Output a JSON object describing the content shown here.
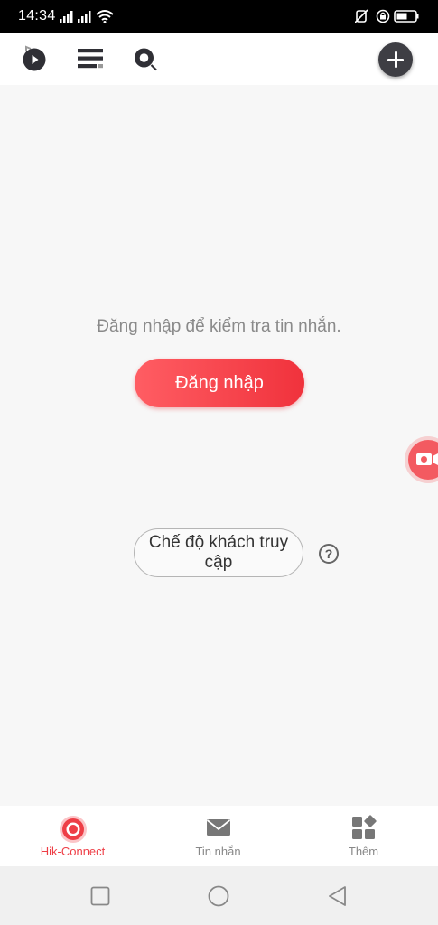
{
  "status_bar": {
    "time": "14:34"
  },
  "top_bar": {
    "icons": [
      "play-icon",
      "list-icon",
      "search-icon",
      "add-icon"
    ]
  },
  "main": {
    "login_message": "Đăng nhập để kiểm tra tin nhắn.",
    "login_button": "Đăng nhập",
    "guest_mode_button": "Chế độ khách truy cập",
    "help_symbol": "?"
  },
  "bottom_nav": {
    "items": [
      {
        "label": "Hik-Connect",
        "icon": "hik-connect-icon",
        "active": true
      },
      {
        "label": "Tin nhắn",
        "icon": "mail-icon",
        "active": false
      },
      {
        "label": "Thêm",
        "icon": "more-grid-icon",
        "active": false
      }
    ]
  },
  "colors": {
    "accent": "#ee3e46",
    "dark_icon": "#2f2f35",
    "background": "#f7f7f7"
  }
}
